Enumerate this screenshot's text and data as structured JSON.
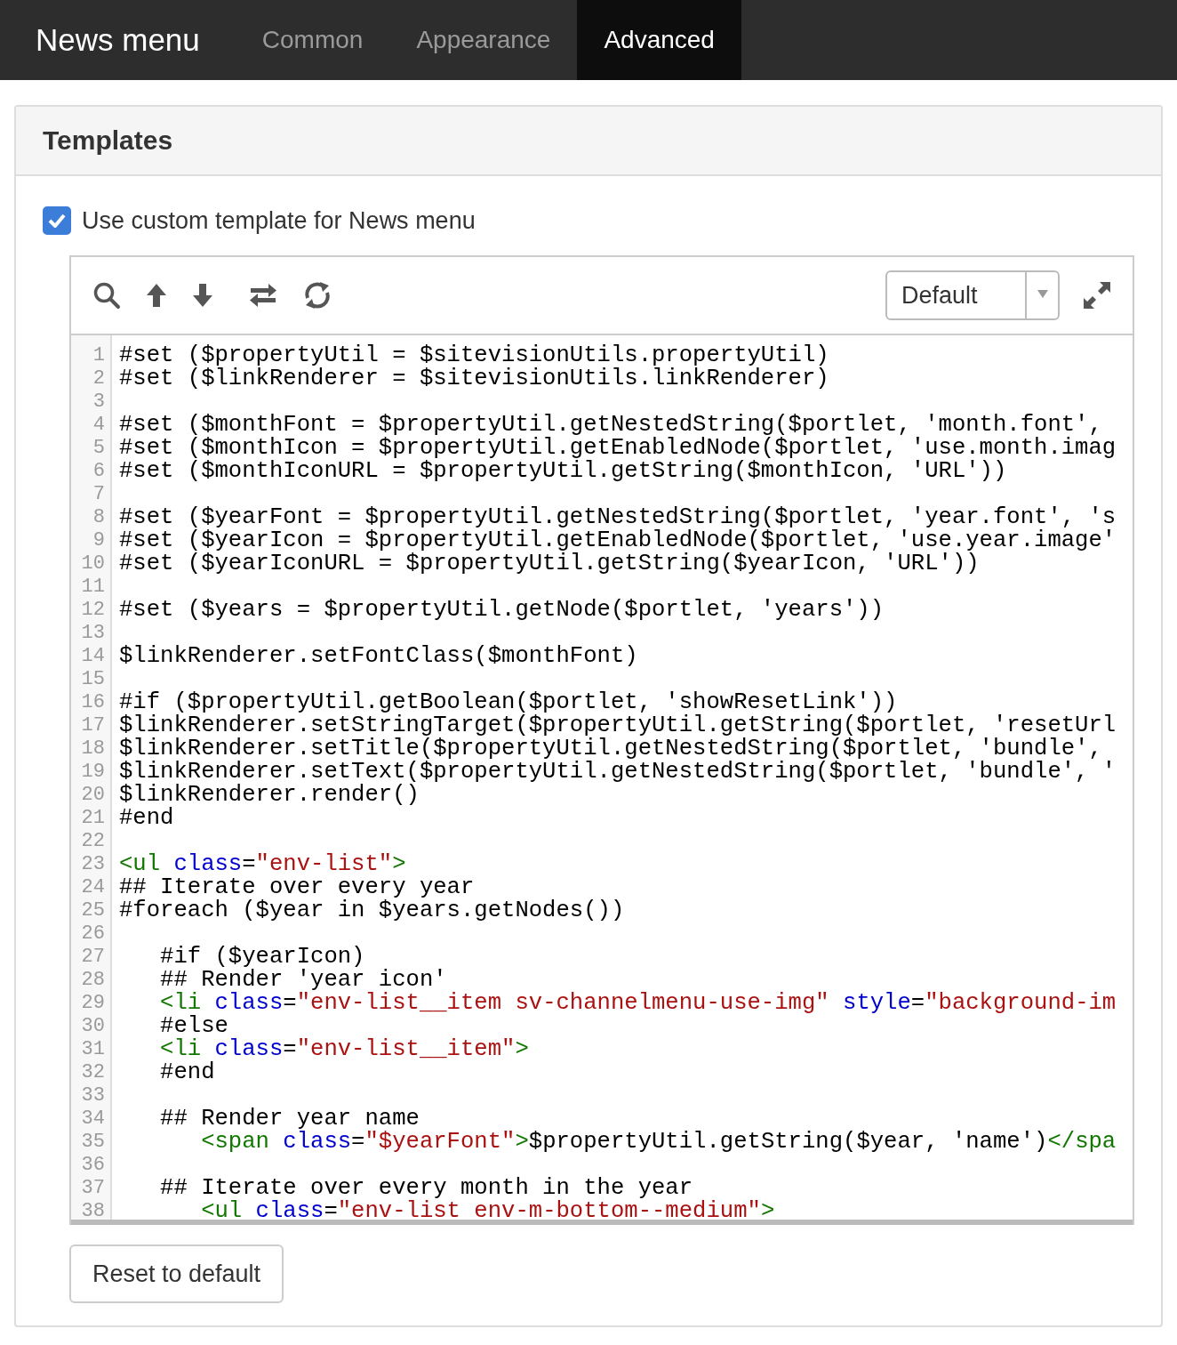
{
  "nav": {
    "title": "News menu",
    "tabs": [
      {
        "label": "Common",
        "selected": false
      },
      {
        "label": "Appearance",
        "selected": false
      },
      {
        "label": "Advanced",
        "selected": true
      }
    ]
  },
  "panel": {
    "title": "Templates",
    "custom_template": {
      "label": "Use custom template for News menu",
      "checked": true
    },
    "editor": {
      "mode": "Default",
      "lines": [
        {
          "number": "1",
          "segments": [
            {
              "kind": "plain",
              "text": "#set ($propertyUtil = $sitevisionUtils.propertyUtil)"
            }
          ]
        },
        {
          "number": "2",
          "segments": [
            {
              "kind": "plain",
              "text": "#set ($linkRenderer = $sitevisionUtils.linkRenderer)"
            }
          ]
        },
        {
          "number": "3"
        },
        {
          "number": "4",
          "segments": [
            {
              "kind": "plain",
              "text": "#set ($monthFont = $propertyUtil.getNestedString($portlet, 'month.font',"
            }
          ]
        },
        {
          "number": "5",
          "segments": [
            {
              "kind": "plain",
              "text": "#set ($monthIcon = $propertyUtil.getEnabledNode($portlet, 'use.month.imag"
            }
          ]
        },
        {
          "number": "6",
          "segments": [
            {
              "kind": "plain",
              "text": "#set ($monthIconURL = $propertyUtil.getString($monthIcon, 'URL'))"
            }
          ]
        },
        {
          "number": "7"
        },
        {
          "number": "8",
          "segments": [
            {
              "kind": "plain",
              "text": "#set ($yearFont = $propertyUtil.getNestedString($portlet, 'year.font', 's"
            }
          ]
        },
        {
          "number": "9",
          "segments": [
            {
              "kind": "plain",
              "text": "#set ($yearIcon = $propertyUtil.getEnabledNode($portlet, 'use.year.image'"
            }
          ]
        },
        {
          "number": "10",
          "segments": [
            {
              "kind": "plain",
              "text": "#set ($yearIconURL = $propertyUtil.getString($yearIcon, 'URL'))"
            }
          ]
        },
        {
          "number": "11"
        },
        {
          "number": "12",
          "segments": [
            {
              "kind": "plain",
              "text": "#set ($years = $propertyUtil.getNode($portlet, 'years'))"
            }
          ]
        },
        {
          "number": "13"
        },
        {
          "number": "14",
          "segments": [
            {
              "kind": "plain",
              "text": "$linkRenderer.setFontClass($monthFont)"
            }
          ]
        },
        {
          "number": "15"
        },
        {
          "number": "16",
          "segments": [
            {
              "kind": "plain",
              "text": "#if ($propertyUtil.getBoolean($portlet, 'showResetLink'))"
            }
          ]
        },
        {
          "number": "17",
          "segments": [
            {
              "kind": "plain",
              "text": "$linkRenderer.setStringTarget($propertyUtil.getString($portlet, 'resetUrl"
            }
          ]
        },
        {
          "number": "18",
          "segments": [
            {
              "kind": "plain",
              "text": "$linkRenderer.setTitle($propertyUtil.getNestedString($portlet, 'bundle',"
            }
          ]
        },
        {
          "number": "19",
          "segments": [
            {
              "kind": "plain",
              "text": "$linkRenderer.setText($propertyUtil.getNestedString($portlet, 'bundle', '"
            }
          ]
        },
        {
          "number": "20",
          "segments": [
            {
              "kind": "plain",
              "text": "$linkRenderer.render()"
            }
          ]
        },
        {
          "number": "21",
          "segments": [
            {
              "kind": "plain",
              "text": "#end"
            }
          ]
        },
        {
          "number": "22"
        },
        {
          "number": "23",
          "segments": [
            {
              "kind": "tag",
              "text": "<ul"
            },
            {
              "kind": "attr",
              "text": " class"
            },
            {
              "kind": "plain",
              "text": "="
            },
            {
              "kind": "string",
              "text": "\"env-list\""
            },
            {
              "kind": "tag",
              "text": ">"
            }
          ]
        },
        {
          "number": "24",
          "segments": [
            {
              "kind": "plain",
              "text": "## Iterate over every year"
            }
          ]
        },
        {
          "number": "25",
          "segments": [
            {
              "kind": "plain",
              "text": "#foreach ($year in $years.getNodes())"
            }
          ]
        },
        {
          "number": "26"
        },
        {
          "number": "27",
          "segments": [
            {
              "kind": "plain",
              "text": "   #if ($yearIcon)"
            }
          ]
        },
        {
          "number": "28",
          "segments": [
            {
              "kind": "plain",
              "text": "   ## Render 'year icon'"
            }
          ]
        },
        {
          "number": "29",
          "segments": [
            {
              "kind": "tag",
              "text": "   <li"
            },
            {
              "kind": "attr",
              "text": " class"
            },
            {
              "kind": "plain",
              "text": "="
            },
            {
              "kind": "string",
              "text": "\"env-list__item sv-channelmenu-use-img\""
            },
            {
              "kind": "attr",
              "text": " style"
            },
            {
              "kind": "plain",
              "text": "="
            },
            {
              "kind": "string",
              "text": "\"background-im"
            }
          ]
        },
        {
          "number": "30",
          "segments": [
            {
              "kind": "plain",
              "text": "   #else"
            }
          ]
        },
        {
          "number": "31",
          "segments": [
            {
              "kind": "tag",
              "text": "   <li"
            },
            {
              "kind": "attr",
              "text": " class"
            },
            {
              "kind": "plain",
              "text": "="
            },
            {
              "kind": "string",
              "text": "\"env-list__item\""
            },
            {
              "kind": "tag",
              "text": ">"
            }
          ]
        },
        {
          "number": "32",
          "segments": [
            {
              "kind": "plain",
              "text": "   #end"
            }
          ]
        },
        {
          "number": "33"
        },
        {
          "number": "34",
          "segments": [
            {
              "kind": "plain",
              "text": "   ## Render year name"
            }
          ]
        },
        {
          "number": "35",
          "segments": [
            {
              "kind": "tag",
              "text": "      <span"
            },
            {
              "kind": "attr",
              "text": " class"
            },
            {
              "kind": "plain",
              "text": "="
            },
            {
              "kind": "string",
              "text": "\"$yearFont\""
            },
            {
              "kind": "tag",
              "text": ">"
            },
            {
              "kind": "plain",
              "text": "$propertyUtil.getString($year, 'name')"
            },
            {
              "kind": "tag",
              "text": "</spa"
            }
          ]
        },
        {
          "number": "36"
        },
        {
          "number": "37",
          "segments": [
            {
              "kind": "plain",
              "text": "   ## Iterate over every month in the year"
            }
          ]
        },
        {
          "number": "38",
          "segments": [
            {
              "kind": "tag",
              "text": "      <ul"
            },
            {
              "kind": "attr",
              "text": " class"
            },
            {
              "kind": "plain",
              "text": "="
            },
            {
              "kind": "string",
              "text": "\"env-list env-m-bottom--medium\""
            },
            {
              "kind": "tag",
              "text": ">"
            }
          ]
        }
      ]
    },
    "reset_button": "Reset to default"
  }
}
